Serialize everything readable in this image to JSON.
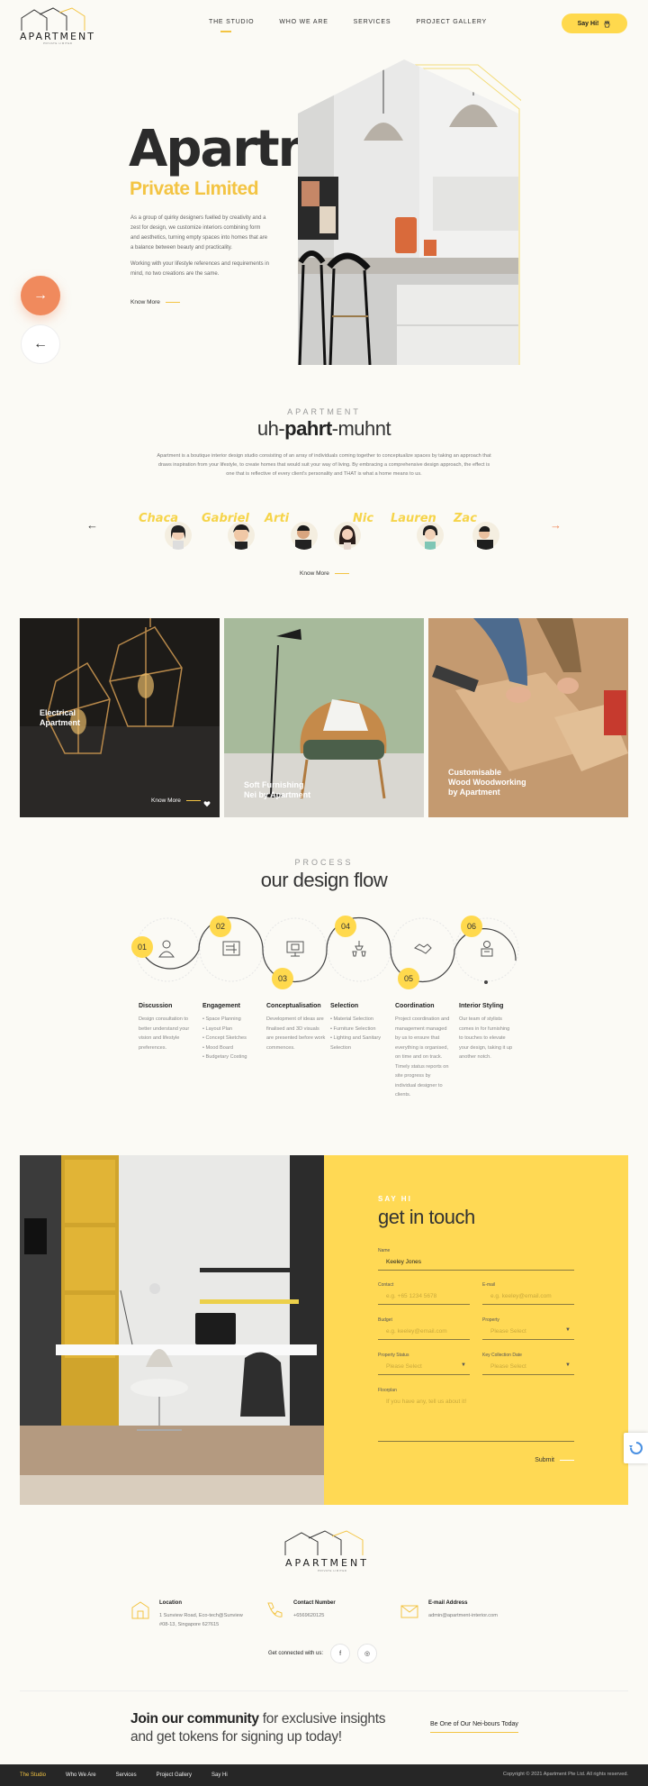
{
  "brand": {
    "logo_text": "APARTMENT",
    "logo_sub": "PRIVATE LIMITED",
    "accent": "#ffd94d",
    "coral": "#f08a5d"
  },
  "nav": {
    "items": [
      "THE STUDIO",
      "WHO WE ARE",
      "SERVICES",
      "PROJECT GALLERY"
    ],
    "cta": "Say Hi!"
  },
  "hero": {
    "title": "Apartment",
    "subtitle": "Private Limited",
    "p1": "As a group of quirky designers fuelled by creativity and a zest for design, we customize interiors combining form and aesthetics, turning empty spaces into homes that are a balance between beauty and practicality.",
    "p2": "Working with your lifestyle references and requirements in mind, no two creations are the same.",
    "know_more": "Know More",
    "next": "→",
    "prev": "←"
  },
  "about": {
    "label": "APARTMENT",
    "title_a": "uh-",
    "title_b": "pahrt",
    "title_c": "-muhnt",
    "text": "Apartment is a boutique interior design studio consisting of an array of individuals coming together to conceptualize spaces by taking an approach that draws inspiration from your lifestyle, to create homes that would suit your way of living. By embracing a comprehensive design approach, the effect is one that is reflective of every client's personality and THAT is what a home means to us.",
    "team": [
      "Chaca",
      "Gabriel",
      "Arti",
      "Nic",
      "Lauren",
      "Zac"
    ],
    "know_more": "Know More",
    "arrow_left": "←",
    "arrow_right": "→"
  },
  "cards": [
    {
      "label_1": "Electrical",
      "label_2": "Apartment",
      "know_more": "Know More"
    },
    {
      "label_1": "Soft Furnishing",
      "label_2": "Nei by Apartment"
    },
    {
      "label_1": "Customisable",
      "label_2": "Wood Woodworking",
      "label_3": "by Apartment"
    }
  ],
  "process": {
    "label": "PROCESS",
    "title": "our design flow",
    "steps": [
      {
        "num": "01",
        "title": "Discussion",
        "text": "Design consultation to better understand your vision and lifestyle preferences."
      },
      {
        "num": "02",
        "title": "Engagement",
        "items": [
          "Space Planning",
          "Layout Plan",
          "Concept Sketches",
          "Mood Board",
          "Budgetary Costing"
        ]
      },
      {
        "num": "03",
        "title": "Conceptualisation",
        "text": "Development of ideas are finalised and 3D visuals are presented before work commences."
      },
      {
        "num": "04",
        "title": "Selection",
        "items": [
          "Material Selection",
          "Furniture Selection",
          "Lighting and Sanitary Selection"
        ]
      },
      {
        "num": "05",
        "title": "Coordination",
        "text": "Project coordination and management managed by us to ensure that everything is organised, on time and on track. Timely status reports on site progress by individual designer to clients."
      },
      {
        "num": "06",
        "title": "Interior Styling",
        "text": "Our team of stylists comes in for furnishing to touches to elevate your design, taking it up another notch."
      }
    ]
  },
  "contact": {
    "label": "SAY HI",
    "title": "get in touch",
    "name_label": "Name",
    "name_value": "Keeley Jones",
    "contact_label": "Contact",
    "contact_ph": "e.g. +65 1234 5678",
    "email_label": "E-mail",
    "email_ph": "e.g. keeley@email.com",
    "budget_label": "Budget",
    "budget_ph": "e.g. keeley@email.com",
    "property_label": "Property",
    "property_ph": "Please Select",
    "status_label": "Property Status",
    "status_ph": "Please Select",
    "key_label": "Key Collection Date",
    "key_ph": "Please Select",
    "floorplan_label": "Floorplan",
    "floorplan_ph": "If you have any, tell us about it!",
    "submit": "Submit"
  },
  "footer": {
    "location_title": "Location",
    "location_1": "1 Sunview Road, Eco-tech@Sunview",
    "location_2": "#08-13, Singapore 627615",
    "contact_title": "Contact Number",
    "contact_value": "+6569620125",
    "email_title": "E-mail Address",
    "email_value": "admin@apartment-interior.com",
    "social_label": "Get connected with us:",
    "facebook": "f",
    "instagram": "◎",
    "join_bold": "Join our community",
    "join_rest": " for exclusive insights",
    "join_line2": "and get tokens for signing up today!",
    "join_cta": "Be One of Our Nei-bours Today"
  },
  "bottom": {
    "links": [
      "The Studio",
      "Who We Are",
      "Services",
      "Project Gallery",
      "Say Hi"
    ],
    "copyright": "Copyright © 2021 Apartment Pte Ltd. All rights reserved."
  }
}
